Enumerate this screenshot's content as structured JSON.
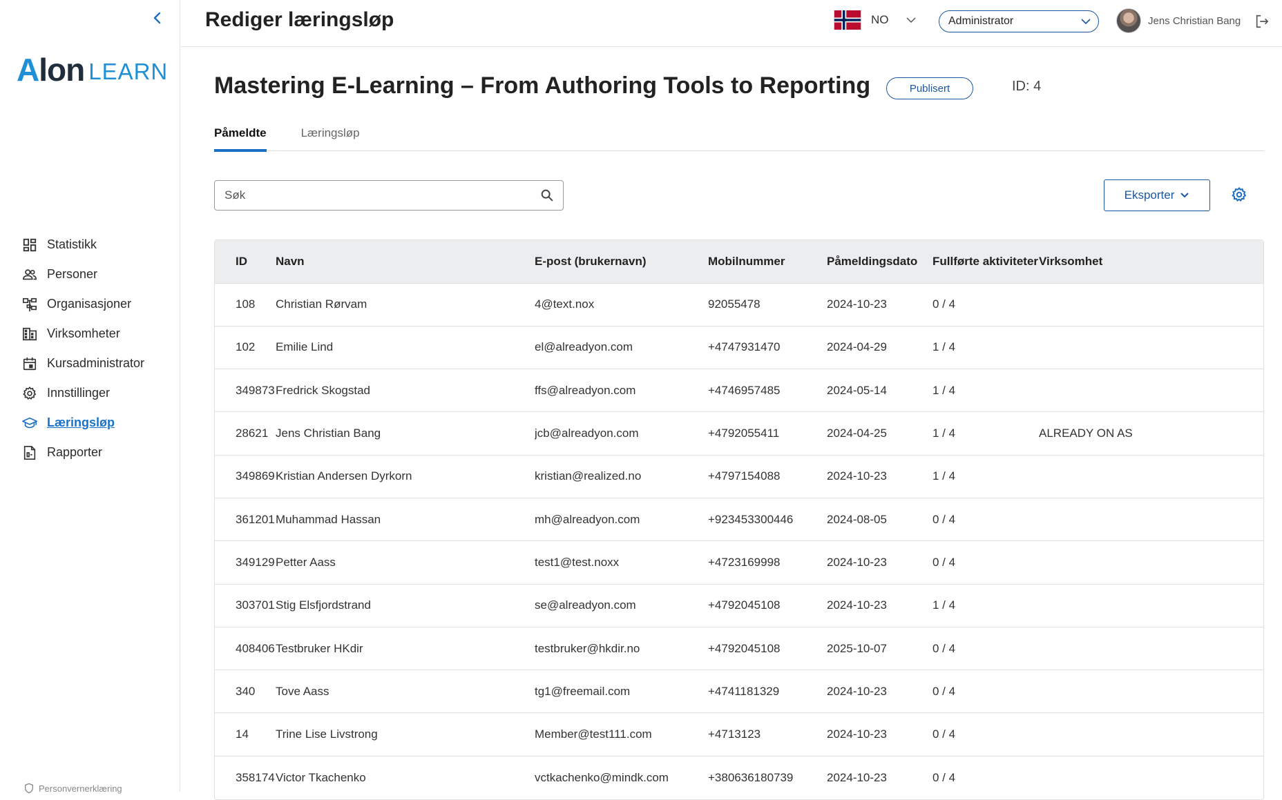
{
  "sidebar": {
    "logo": {
      "brand": "Alon",
      "product": "LEARN"
    },
    "items": [
      {
        "label": "Statistikk",
        "icon": "dashboard-icon"
      },
      {
        "label": "Personer",
        "icon": "people-icon"
      },
      {
        "label": "Organisasjoner",
        "icon": "org-chart-icon"
      },
      {
        "label": "Virksomheter",
        "icon": "building-icon"
      },
      {
        "label": "Kursadministrator",
        "icon": "calendar-icon"
      },
      {
        "label": "Innstillinger",
        "icon": "gear-icon"
      },
      {
        "label": "Læringsløp",
        "icon": "graduation-cap-icon",
        "active": true
      },
      {
        "label": "Rapporter",
        "icon": "report-icon"
      }
    ],
    "footer_text": "Personvernerklæring"
  },
  "header": {
    "title": "Rediger læringsløp",
    "language": "NO",
    "role": "Administrator",
    "user_name": "Jens Christian Bang"
  },
  "course": {
    "title": "Mastering E-Learning – From Authoring Tools to Reporting",
    "status": "Publisert",
    "id_label": "ID: 4"
  },
  "tabs": [
    {
      "label": "Påmeldte",
      "active": true
    },
    {
      "label": "Læringsløp",
      "active": false
    }
  ],
  "search": {
    "placeholder": "Søk",
    "value": ""
  },
  "toolbar": {
    "export_label": "Eksporter"
  },
  "table": {
    "columns": [
      "ID",
      "Navn",
      "E-post (brukernavn)",
      "Mobilnummer",
      "Påmeldingsdato",
      "Fullførte aktiviteter",
      "Virksomhet"
    ],
    "rows": [
      [
        "108",
        "Christian Rørvam",
        "4@text.nox",
        "92055478",
        "2024-10-23",
        "0 / 4",
        ""
      ],
      [
        "102",
        "Emilie Lind",
        "el@alreadyon.com",
        "+4747931470",
        "2024-04-29",
        "1 / 4",
        ""
      ],
      [
        "349873",
        "Fredrick Skogstad",
        "ffs@alreadyon.com",
        "+4746957485",
        "2024-05-14",
        "1 / 4",
        ""
      ],
      [
        "28621",
        "Jens Christian Bang",
        "jcb@alreadyon.com",
        "+4792055411",
        "2024-04-25",
        "1 / 4",
        "ALREADY ON AS"
      ],
      [
        "349869",
        "Kristian Andersen Dyrkorn",
        "kristian@realized.no",
        "+4797154088",
        "2024-10-23",
        "1 / 4",
        ""
      ],
      [
        "361201",
        "Muhammad Hassan",
        "mh@alreadyon.com",
        "+923453300446",
        "2024-08-05",
        "0 / 4",
        ""
      ],
      [
        "349129",
        "Petter Aass",
        "test1@test.noxx",
        "+4723169998",
        "2024-10-23",
        "0 / 4",
        ""
      ],
      [
        "303701",
        "Stig Elsfjordstrand",
        "se@alreadyon.com",
        "+4792045108",
        "2024-10-23",
        "1 / 4",
        ""
      ],
      [
        "408406",
        "Testbruker HKdir",
        "testbruker@hkdir.no",
        "+4792045108",
        "2025-10-07",
        "0 / 4",
        ""
      ],
      [
        "340",
        "Tove Aass",
        "tg1@freemail.com",
        "+4741181329",
        "2024-10-23",
        "0 / 4",
        ""
      ],
      [
        "14",
        "Trine Lise Livstrong",
        "Member@test111.com",
        "+4713123",
        "2024-10-23",
        "0 / 4",
        ""
      ],
      [
        "358174",
        "Victor Tkachenko",
        "vctkachenko@mindk.com",
        "+380636180739",
        "2024-10-23",
        "0 / 4",
        ""
      ]
    ]
  },
  "colors": {
    "accent": "#1a6fc4",
    "brand_dark": "#1f2e3a",
    "header_bg": "#ecedef"
  }
}
